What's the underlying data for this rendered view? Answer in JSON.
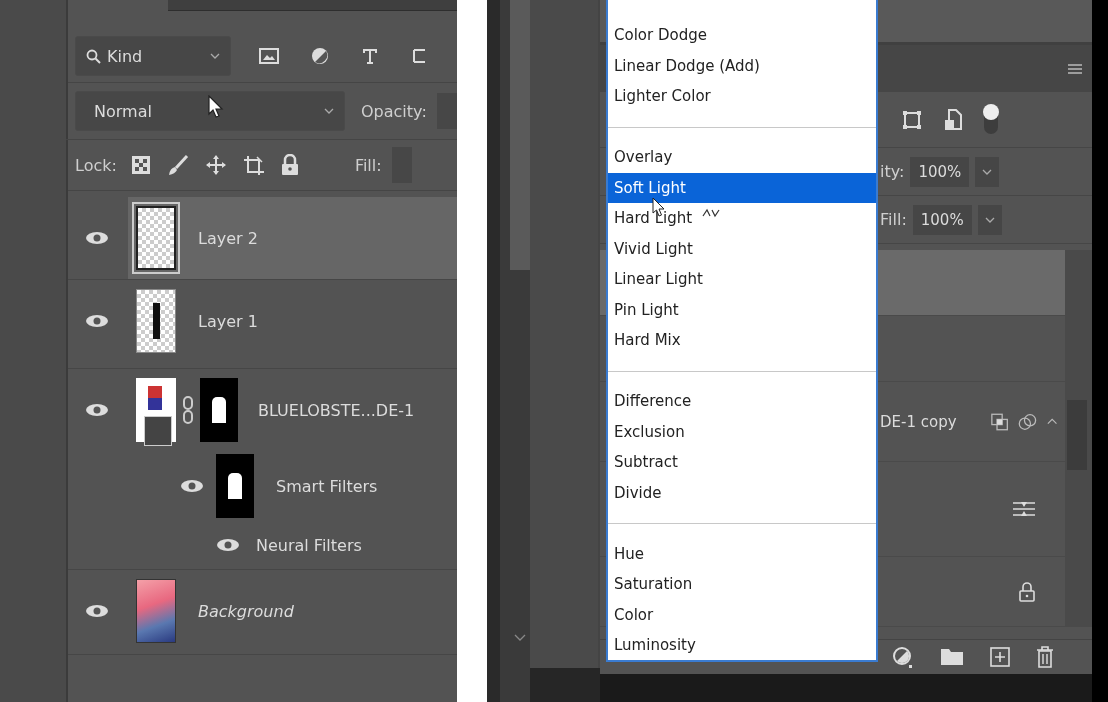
{
  "left_panel": {
    "filter": {
      "value": "Kind"
    },
    "blend_mode": {
      "value": "Normal"
    },
    "opacity_label": "Opacity:",
    "lock_label": "Lock:",
    "fill_label": "Fill:",
    "layers": [
      {
        "name": "Layer 2",
        "kind": "transparent",
        "selected": true,
        "visible": true
      },
      {
        "name": "Layer 1",
        "kind": "transparent-bar",
        "selected": false,
        "visible": true
      },
      {
        "name": "BLUELOBSTE...DE-1",
        "kind": "smart",
        "selected": false,
        "visible": true,
        "children": [
          {
            "name": "Smart Filters",
            "kind": "smart-filters",
            "visible": true
          },
          {
            "name": "Neural Filters",
            "kind": "filter",
            "visible": true
          }
        ]
      },
      {
        "name": "Background",
        "kind": "background",
        "selected": false,
        "visible": true
      }
    ]
  },
  "right_panel": {
    "filter_on": true,
    "opacity_label": "ity:",
    "opacity_value": "100%",
    "fill_label": "Fill:",
    "fill_value": "100%",
    "layer_rows": [
      {
        "kind": "plain",
        "selected": true
      },
      {
        "kind": "plain",
        "selected": false
      },
      {
        "kind": "smart",
        "name": "DE-1 copy",
        "selected": false
      },
      {
        "kind": "filters",
        "selected": false
      },
      {
        "kind": "locked",
        "selected": false
      }
    ],
    "blend_menu": {
      "groups": [
        {
          "items": [
            {
              "label": "Color Dodge",
              "selected": false
            },
            {
              "label": "Linear Dodge (Add)",
              "selected": false
            },
            {
              "label": "Lighter Color",
              "selected": false
            }
          ]
        },
        {
          "items": [
            {
              "label": "Overlay",
              "selected": false
            },
            {
              "label": "Soft Light",
              "selected": true
            },
            {
              "label": "Hard Light",
              "selected": false
            },
            {
              "label": "Vivid Light",
              "selected": false
            },
            {
              "label": "Linear Light",
              "selected": false
            },
            {
              "label": "Pin Light",
              "selected": false
            },
            {
              "label": "Hard Mix",
              "selected": false
            }
          ]
        },
        {
          "items": [
            {
              "label": "Difference",
              "selected": false
            },
            {
              "label": "Exclusion",
              "selected": false
            },
            {
              "label": "Subtract",
              "selected": false
            },
            {
              "label": "Divide",
              "selected": false
            }
          ]
        },
        {
          "items": [
            {
              "label": "Hue",
              "selected": false
            },
            {
              "label": "Saturation",
              "selected": false
            },
            {
              "label": "Color",
              "selected": false
            },
            {
              "label": "Luminosity",
              "selected": false
            }
          ]
        }
      ]
    }
  }
}
